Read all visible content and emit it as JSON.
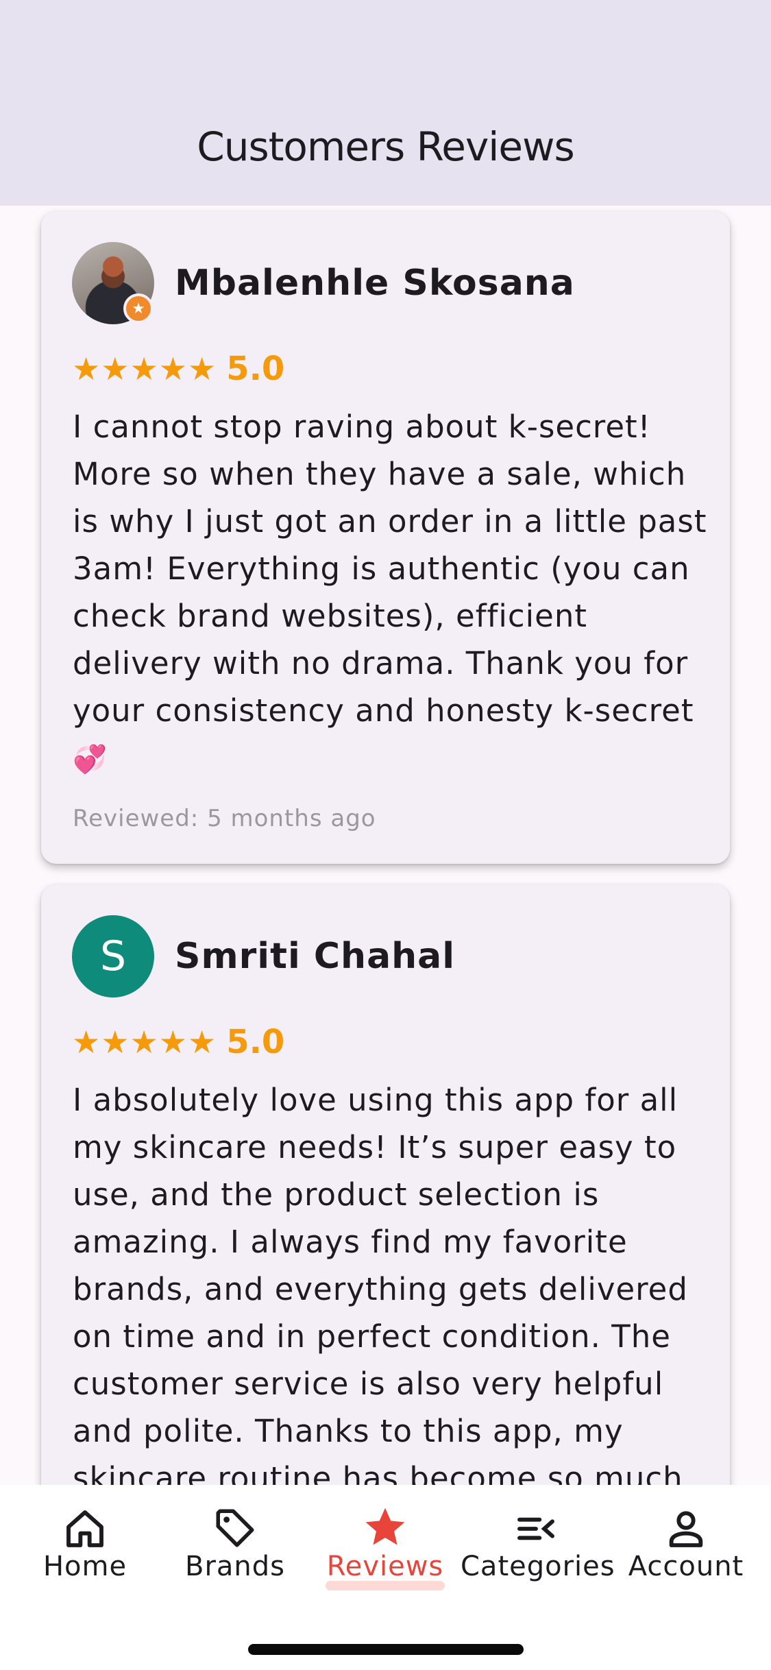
{
  "app_bar": {
    "title": "Customers Reviews"
  },
  "reviews": [
    {
      "name": "Mbalenhle Skosana",
      "stars": "★★★★★",
      "rating": "5.0",
      "text": "I cannot stop raving about k-secret! More so when they have a sale, which is why I just got an order in a little past 3am! Everything is authentic (you can check brand websites), efficient delivery with no drama. Thank you for your consistency and honesty k-secret",
      "emoji": "💞",
      "reviewed": "Reviewed: 5 months ago"
    },
    {
      "name": "Smriti Chahal",
      "avatar_letter": "S",
      "stars": "★★★★★",
      "rating": "5.0",
      "text": "I absolutely love using this app for all my skincare needs! It’s super easy to use, and the product selection is amazing. I always find my favorite brands, and everything gets delivered on time and in perfect condition. The customer service is also very helpful and polite. Thanks to this app, my skincare routine has become so much"
    }
  ],
  "nav": {
    "items": [
      {
        "label": "Home",
        "icon": "home-icon"
      },
      {
        "label": "Brands",
        "icon": "tag-icon"
      },
      {
        "label": "Reviews",
        "icon": "star-icon"
      },
      {
        "label": "Categories",
        "icon": "categories-icon"
      },
      {
        "label": "Account",
        "icon": "person-icon"
      }
    ],
    "active": "Reviews"
  },
  "colors": {
    "app_bar_bg": "#e7e2ef",
    "card_bg": "#f4eff7",
    "star": "#f59a0b",
    "active_nav": "#e8443a",
    "avatar_teal": "#0e8b7a"
  }
}
